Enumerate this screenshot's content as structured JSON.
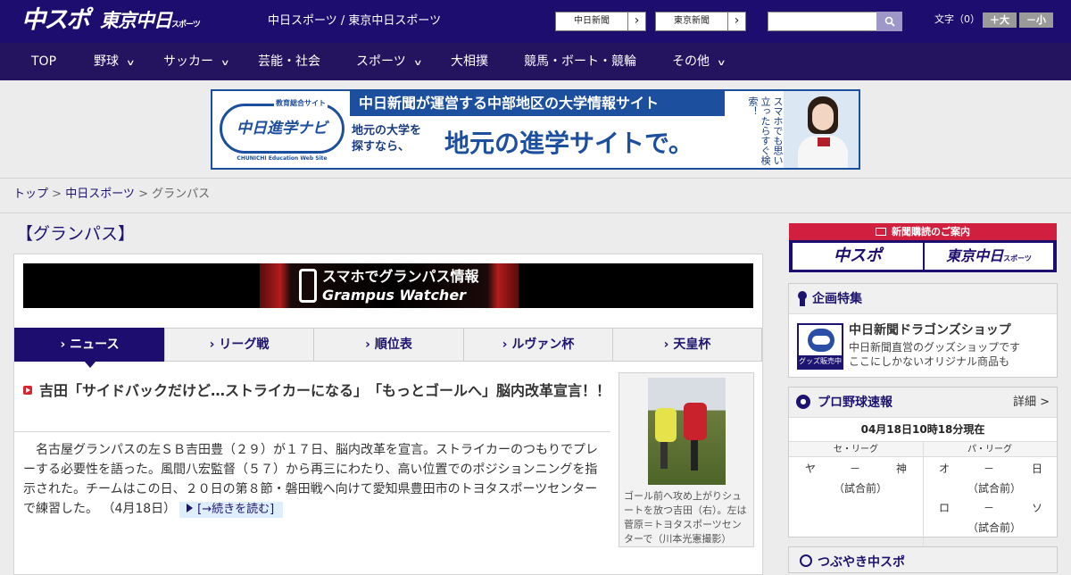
{
  "header": {
    "logo_chuspo": "中スポ",
    "logo_tokyo": "東京中日",
    "logo_tokyo_small": "スポーツ",
    "site_title": "中日スポーツ / 東京中日スポーツ",
    "btn_chunichi": "中日新聞",
    "btn_tokyo": "東京新聞",
    "arrow": "›",
    "search_placeholder": "",
    "font_label": "文字（0）",
    "font_large": "＋大",
    "font_small": "－小"
  },
  "nav": {
    "items": [
      "TOP",
      "野球",
      "サッカー",
      "芸能・社会",
      "スポーツ",
      "大相撲",
      "競馬・ボート・競輪",
      "その他"
    ],
    "chev": "∨"
  },
  "ad_banner": {
    "logo_top": "教育総合サイト",
    "logo_main": "中日進学ナビ",
    "logo_sub": "CHUNICHI Education Web Site",
    "headline": "中日新聞が運営する中部地区の大学情報サイト",
    "left_line1": "地元の大学を",
    "left_line2": "探すなら、",
    "big": "地元の進学サイトで。",
    "vertical": "スマホでも思い立ったらすぐ検索！"
  },
  "breadcrumb": {
    "top": "トップ",
    "sep": " > ",
    "chuspo": "中日スポーツ",
    "current": "グランパス"
  },
  "section_title": "【グランパス】",
  "grampus_banner": {
    "line1": "スマホでグランパス情報",
    "line2": "Grampus Watcher"
  },
  "tabs": [
    "› ニュース",
    "› リーグ戦",
    "› 順位表",
    "› ルヴァン杯",
    "› 天皇杯"
  ],
  "article": {
    "title": "吉田「サイドバックだけど…ストライカーになる」　「もっとゴールへ」脳内改革宣言！！",
    "body": "名古屋グランパスの左ＳＢ吉田豊（２９）が１７日、脳内改革を宣言。ストライカーのつもりでプレーする必要性を語った。風間八宏監督（５７）から再三にわたり、高い位置でのポジションニングを指示された。チームはこの日、２０日の第８節・磐田戦へ向けて愛知県豊田市のトヨタスポーツセンターで練習した。 （4月18日）",
    "readmore": "[→続きを読む]",
    "caption": "ゴール前へ攻め上がりシュートを放つ吉田（右）。左は菅原＝トヨタスポーツセンターで（川本光憲撮影）"
  },
  "subscribe": {
    "head": "新聞購読のご案内",
    "logo1": "中スポ",
    "logo2": "東京中日",
    "logo2_small": "スポーツ"
  },
  "feature": {
    "title": "企画特集",
    "shop_label": "グッズ販売中",
    "shop_title": "中日新聞ドラゴンズショップ",
    "shop_desc1": "中日新聞直営のグッズショップです",
    "shop_desc2": "ここにしかないオリジナル商品も"
  },
  "baseball": {
    "title": "プロ野球速報",
    "detail": "詳細 >",
    "time": "04月18日10時18分現在",
    "central": "セ・リーグ",
    "pacific": "パ・リーグ",
    "dash": "－",
    "status": "（試合前）",
    "games": [
      {
        "home": "ヤ",
        "away": "神"
      },
      {
        "home": "オ",
        "away": "日"
      },
      {
        "home": "ロ",
        "away": "ソ"
      }
    ]
  },
  "tsubuyaki": {
    "title": "つぶやき中スポ"
  },
  "colors": {
    "header_bg": "#1d0d6e",
    "nav_bg": "#24135f",
    "accent_red": "#d1203f",
    "link": "#1d1370"
  }
}
